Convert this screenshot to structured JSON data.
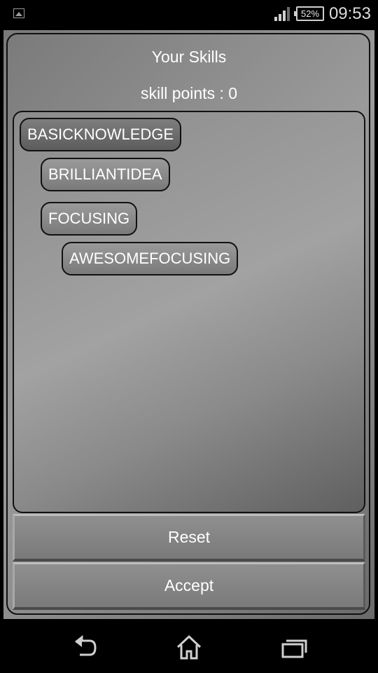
{
  "status_bar": {
    "battery_percent": "52%",
    "time": "09:53"
  },
  "screen": {
    "title": "Your Skills",
    "skill_points": "skill points : 0"
  },
  "skills": [
    {
      "label": "BASICKNOWLEDGE",
      "level": 0
    },
    {
      "label": "BRILLIANTIDEA",
      "level": 1
    },
    {
      "label": "FOCUSING",
      "level": 1
    },
    {
      "label": "AWESOMEFOCUSING",
      "level": 2
    }
  ],
  "buttons": {
    "reset": "Reset",
    "accept": "Accept"
  },
  "nav": {
    "icons": [
      "back-icon",
      "home-icon",
      "recent-apps-icon"
    ]
  }
}
